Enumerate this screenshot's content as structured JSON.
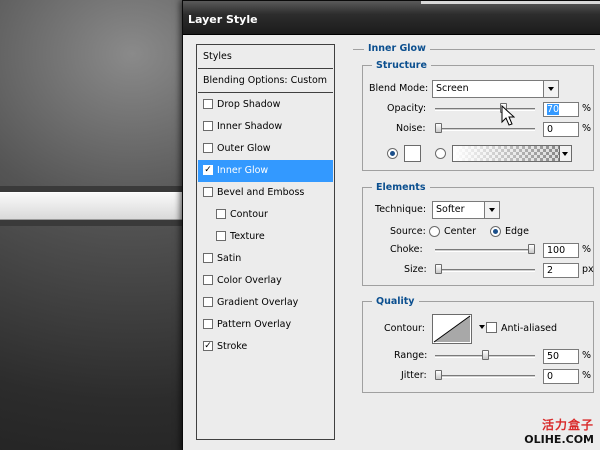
{
  "dialog": {
    "title": "Layer Style"
  },
  "styles_list": {
    "header": "Styles",
    "blending": "Blending Options: Custom",
    "items": [
      {
        "label": "Drop Shadow",
        "checked": false,
        "indent": false
      },
      {
        "label": "Inner Shadow",
        "checked": false,
        "indent": false
      },
      {
        "label": "Outer Glow",
        "checked": false,
        "indent": false
      },
      {
        "label": "Inner Glow",
        "checked": true,
        "indent": false,
        "selected": true
      },
      {
        "label": "Bevel and Emboss",
        "checked": false,
        "indent": false
      },
      {
        "label": "Contour",
        "checked": false,
        "indent": true
      },
      {
        "label": "Texture",
        "checked": false,
        "indent": true
      },
      {
        "label": "Satin",
        "checked": false,
        "indent": false
      },
      {
        "label": "Color Overlay",
        "checked": false,
        "indent": false
      },
      {
        "label": "Gradient Overlay",
        "checked": false,
        "indent": false
      },
      {
        "label": "Pattern Overlay",
        "checked": false,
        "indent": false
      },
      {
        "label": "Stroke",
        "checked": true,
        "indent": false
      }
    ]
  },
  "inner_glow": {
    "title": "Inner Glow",
    "structure": {
      "title": "Structure",
      "blend_mode_label": "Blend Mode:",
      "blend_mode_value": "Screen",
      "opacity_label": "Opacity:",
      "opacity_value": "70",
      "opacity_unit": "%",
      "opacity_fraction": 0.7,
      "noise_label": "Noise:",
      "noise_value": "0",
      "noise_unit": "%",
      "noise_fraction": 0.0,
      "color_swatch": "#ffffff"
    },
    "elements": {
      "title": "Elements",
      "technique_label": "Technique:",
      "technique_value": "Softer",
      "source_label": "Source:",
      "source_center": "Center",
      "source_edge": "Edge",
      "source_selected": "Edge",
      "choke_label": "Choke:",
      "choke_value": "100",
      "choke_unit": "%",
      "choke_fraction": 1.0,
      "size_label": "Size:",
      "size_value": "2",
      "size_unit": "px",
      "size_fraction": 0.0
    },
    "quality": {
      "title": "Quality",
      "contour_label": "Contour:",
      "anti_aliased_label": "Anti-aliased",
      "anti_aliased_checked": false,
      "range_label": "Range:",
      "range_value": "50",
      "range_unit": "%",
      "range_fraction": 0.5,
      "jitter_label": "Jitter:",
      "jitter_value": "0",
      "jitter_unit": "%",
      "jitter_fraction": 0.0
    }
  },
  "watermark": {
    "cn": "活力盒子",
    "en": "OLIHE.COM"
  },
  "colors": {
    "accent_blue": "#3399ff",
    "group_title": "#0b4f8f"
  }
}
